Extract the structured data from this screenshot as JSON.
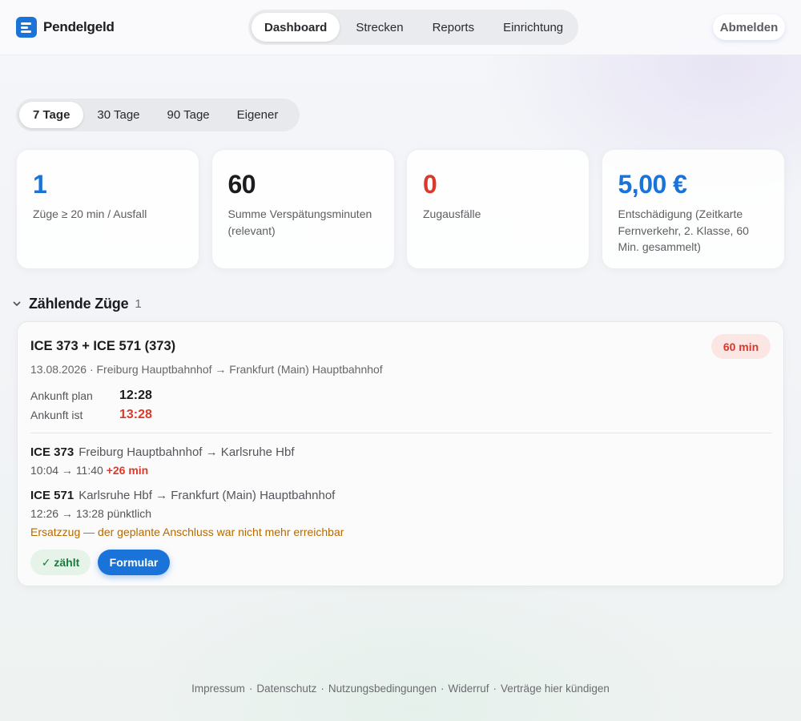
{
  "header": {
    "brand": "Pendelgeld",
    "nav": [
      "Dashboard",
      "Strecken",
      "Reports",
      "Einrichtung"
    ],
    "active_nav": "Dashboard",
    "logout_label": "Abmelden"
  },
  "range": {
    "options": [
      "7 Tage",
      "30 Tage",
      "90 Tage",
      "Eigener"
    ],
    "selected": "7 Tage"
  },
  "stats": [
    {
      "value": "1",
      "label": "Züge ≥ 20 min / Ausfall",
      "color": "#1a73d9"
    },
    {
      "value": "60",
      "label": "Summe Verspätungsminuten (relevant)",
      "color": "#1c1c1e"
    },
    {
      "value": "0",
      "label": "Zugausfälle",
      "color": "#d93a2b"
    },
    {
      "value": "5,00 €",
      "label": "Entschädigung (Zeitkarte Fernverkehr, 2. Klasse, 60 Min. gesammelt)",
      "color": "#1a73d9"
    }
  ],
  "section": {
    "title": "Zählende Züge",
    "count": "1"
  },
  "trip": {
    "title": "ICE 373 + ICE 571 (373)",
    "delay_badge": "60 min",
    "route": "13.08.2026 · Freiburg Hauptbahnhof → Frankfurt (Main) Hauptbahnhof",
    "arrival_plan_label": "Ankunft plan",
    "arrival_plan": "12:28",
    "arrival_actual_label": "Ankunft ist",
    "arrival_actual": "13:28",
    "legs": [
      {
        "train": "ICE 373",
        "route": "Freiburg Hauptbahnhof → Karlsruhe Hbf",
        "times": "10:04 → 11:40",
        "status": "+26 min"
      },
      {
        "train": "ICE 571",
        "route": "Karlsruhe Hbf → Frankfurt (Main) Hauptbahnhof",
        "times": "12:26 → 13:28",
        "status": "pünktlich"
      }
    ],
    "replacement_note": "Ersatzzug — der geplante Anschluss war nicht mehr erreichbar",
    "counts_label": "✓ zählt",
    "form_label": "Formular"
  },
  "footer": {
    "links": [
      "Impressum",
      "Datenschutz",
      "Nutzungsbedingungen",
      "Widerruf",
      "Verträge hier kündigen"
    ],
    "separator": "·"
  }
}
